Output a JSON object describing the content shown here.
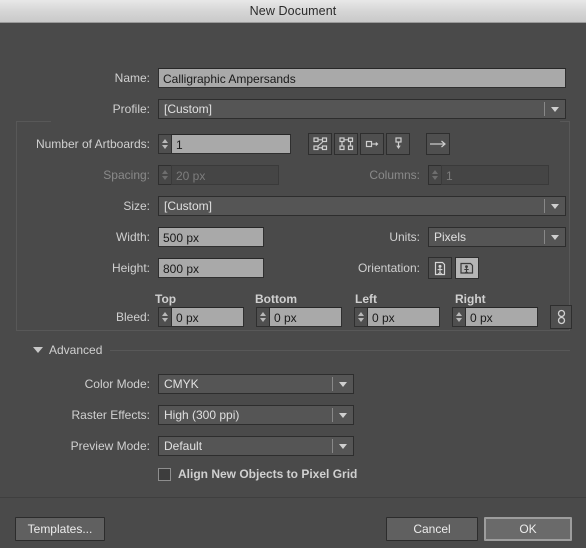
{
  "window": {
    "title": "New Document"
  },
  "fields": {
    "name": {
      "label": "Name:",
      "value": "Calligraphic Ampersands"
    },
    "profile": {
      "label": "Profile:",
      "value": "[Custom]"
    },
    "artboards": {
      "label": "Number of Artboards:",
      "value": "1",
      "icons": {
        "grid_by_row": "grid-by-row-icon",
        "grid_by_column": "grid-by-column-icon",
        "arrange_by_row": "arrange-by-row-icon",
        "arrange_by_column": "arrange-by-column-icon",
        "flow_direction": "right-to-left-arrow-icon"
      }
    },
    "spacing": {
      "label": "Spacing:",
      "value": "20 px",
      "enabled": false
    },
    "columns": {
      "label": "Columns:",
      "value": "1",
      "enabled": false
    },
    "size": {
      "label": "Size:",
      "value": "[Custom]"
    },
    "width": {
      "label": "Width:",
      "value": "500 px"
    },
    "height": {
      "label": "Height:",
      "value": "800 px"
    },
    "units": {
      "label": "Units:",
      "value": "Pixels"
    },
    "orientation": {
      "label": "Orientation:",
      "portrait_icon": "portrait-orientation-icon",
      "landscape_icon": "landscape-orientation-icon",
      "selected": "landscape"
    },
    "bleed": {
      "label": "Bleed:",
      "headers": {
        "top": "Top",
        "bottom": "Bottom",
        "left": "Left",
        "right": "Right"
      },
      "values": {
        "top": "0 px",
        "bottom": "0 px",
        "left": "0 px",
        "right": "0 px"
      },
      "link_icon": "chain-link-icon"
    }
  },
  "advanced": {
    "title": "Advanced",
    "color_mode": {
      "label": "Color Mode:",
      "value": "CMYK"
    },
    "raster_effects": {
      "label": "Raster Effects:",
      "value": "High (300 ppi)"
    },
    "preview_mode": {
      "label": "Preview Mode:",
      "value": "Default"
    },
    "align_pixel_grid": {
      "label": "Align New Objects to Pixel Grid",
      "checked": false
    }
  },
  "footer": {
    "templates": "Templates...",
    "cancel": "Cancel",
    "ok": "OK"
  },
  "colors": {
    "background": "#4a4a4a",
    "field_active": "#a9a9a9",
    "text": "#d0d0d0"
  }
}
